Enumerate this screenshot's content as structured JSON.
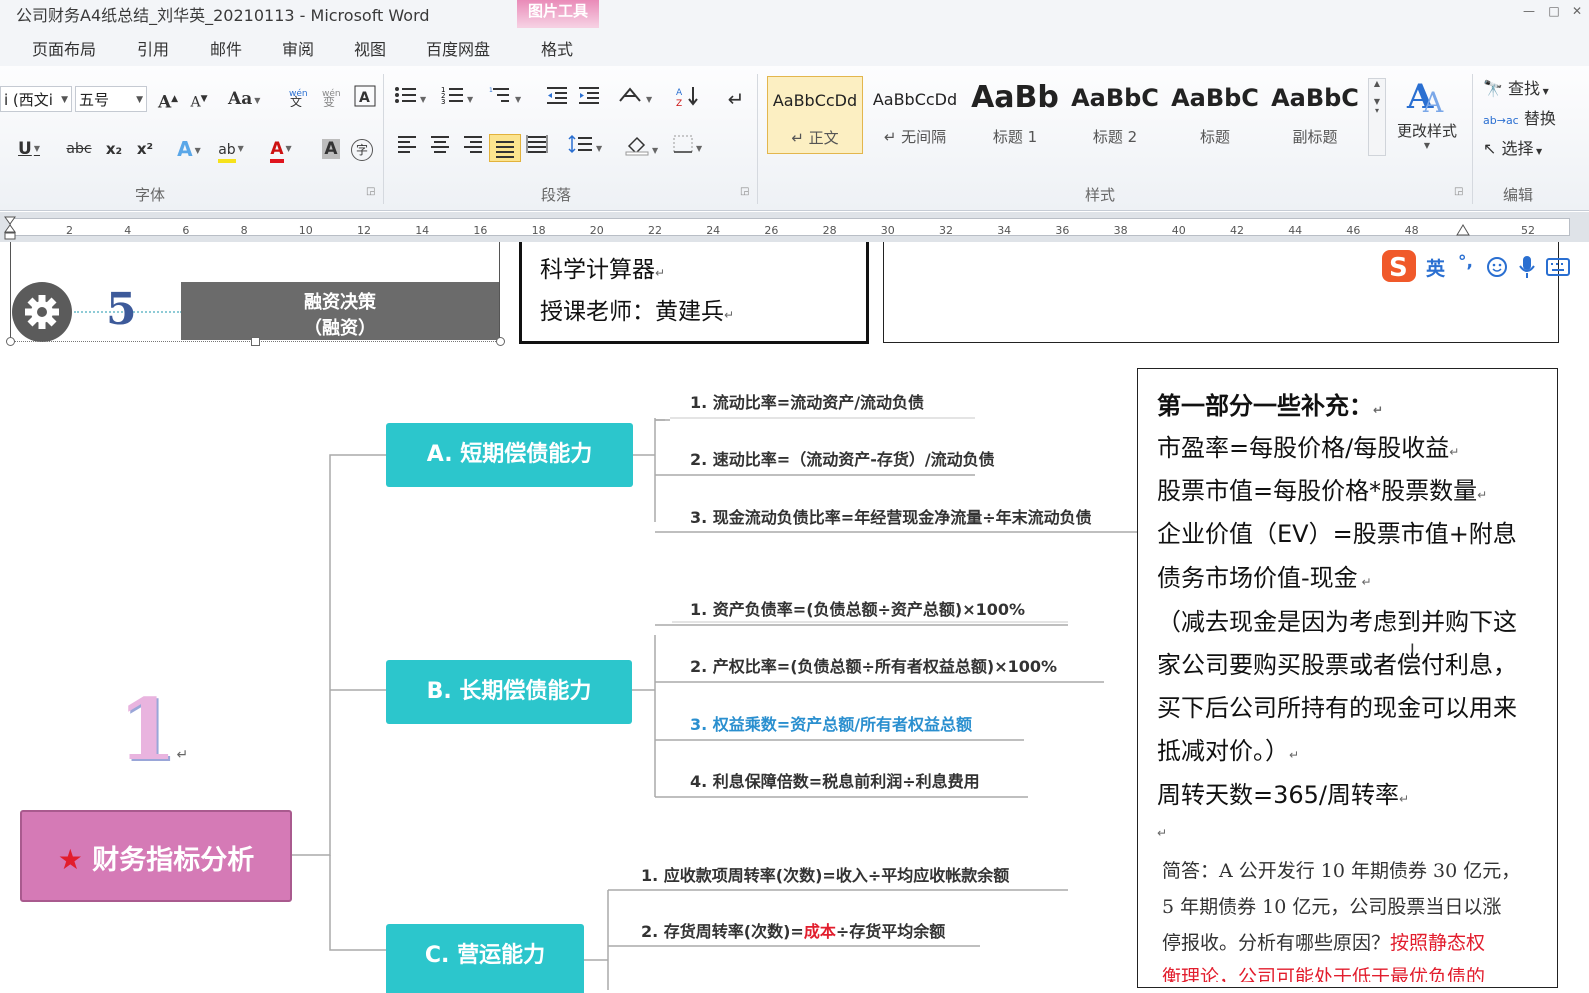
{
  "window": {
    "title": "公司财务A4纸总结_刘华英_20210113 - Microsoft Word",
    "context_tool": "图片工具",
    "controls": [
      "—",
      "□",
      "✕"
    ]
  },
  "tabs": [
    "页面布局",
    "引用",
    "邮件",
    "审阅",
    "视图",
    "百度网盘",
    "格式"
  ],
  "ribbon": {
    "font": {
      "name": "i (西文i",
      "size": "五号",
      "grow": "A",
      "shrink": "A",
      "case": "Aa",
      "underline": "U",
      "strike": "abc",
      "subscript": "x₂",
      "superscript": "x²",
      "text_effect": "A",
      "highlight": "ab",
      "font_color": "A",
      "char_shading": "A",
      "enclose": "字",
      "group_label": "字体"
    },
    "paragraph": {
      "group_label": "段落"
    },
    "styles": {
      "items": [
        {
          "sample": "AaBbCcDd",
          "name": "↵ 正文"
        },
        {
          "sample": "AaBbCcDd",
          "name": "↵ 无间隔"
        },
        {
          "sample": "AaBb",
          "name": "标题 1"
        },
        {
          "sample": "AaBbC",
          "name": "标题 2"
        },
        {
          "sample": "AaBbC",
          "name": "标题"
        },
        {
          "sample": "AaBbC",
          "name": "副标题"
        }
      ],
      "change_label": "更改样式",
      "group_label": "样式"
    },
    "editing": {
      "find": "查找",
      "replace": "替换",
      "select": "选择",
      "group_label": "编辑"
    }
  },
  "ruler": {
    "ticks": [
      "2",
      "4",
      "6",
      "8",
      "10",
      "12",
      "14",
      "16",
      "18",
      "20",
      "22",
      "24",
      "26",
      "28",
      "30",
      "32",
      "34",
      "36",
      "38",
      "40",
      "42",
      "44",
      "46",
      "48",
      "52"
    ]
  },
  "document": {
    "top_banner": {
      "number": "5",
      "box_line1": "融资决策",
      "box_line2": "（融资）"
    },
    "course": {
      "line1": "科学计算器",
      "line2": "授课老师：黄建兵"
    },
    "ime": {
      "lang": "英",
      "punct": "°,"
    },
    "mindmap": {
      "section_number": "1",
      "root": "财务指标分析",
      "branches": [
        {
          "label": "A. 短期偿债能力",
          "items": [
            "1.  流动比率=流动资产/流动负债",
            "2.  速动比率=（流动资产-存货）/流动负债",
            "3.  现金流动负债比率=年经营现金净流量÷年末流动负债"
          ]
        },
        {
          "label": "B. 长期偿债能力",
          "items": [
            "1.  资产负债率=(负债总额÷资产总额)×100%",
            "2.  产权比率=(负债总额÷所有者权益总额)×100%",
            "3.  权益乘数=资产总额/所有者权益总额",
            "4.  利息保障倍数=税息前利润÷利息费用"
          ]
        },
        {
          "label": "C. 营运能力",
          "items": [
            "1.  应收款项周转率(次数)=收入÷平均应收帐款余额",
            "2.  存货周转率(次数)=",
            "成本",
            "÷存货平均余额"
          ]
        }
      ]
    },
    "supplement": {
      "title": "第一部分一些补充：",
      "lines": [
        "市盈率=每股价格/每股收益",
        "股票市值=每股价格*股票数量",
        "企业价值（EV）=股票市值+附息",
        "债务市场价值-现金",
        "（减去现金是因为考虑到并购下这",
        "家公司要购买股票或者偿付利息，",
        "买下后公司所持有的现金可以用来",
        "抵减对价。）",
        "周转天数=365/周转率"
      ],
      "qa_line1": "简答：A 公开发行 10 年期债券 30 亿元，",
      "qa_line2": "5 年期债券 10 亿元，公司股票当日以涨",
      "qa_line3a": "停报收。分析有哪些原因？",
      "qa_line3b": "按照静态权",
      "qa_line4": "衡理论，公司可能处于低于最优负债的",
      "para_mark": "↵"
    }
  },
  "colors": {
    "cyan": "#2cc6cc",
    "root_pink": "#d57ab6",
    "context_pink": "#e98bb8",
    "blue_item": "#2a8fcf",
    "red_text": "#e21d2d"
  }
}
